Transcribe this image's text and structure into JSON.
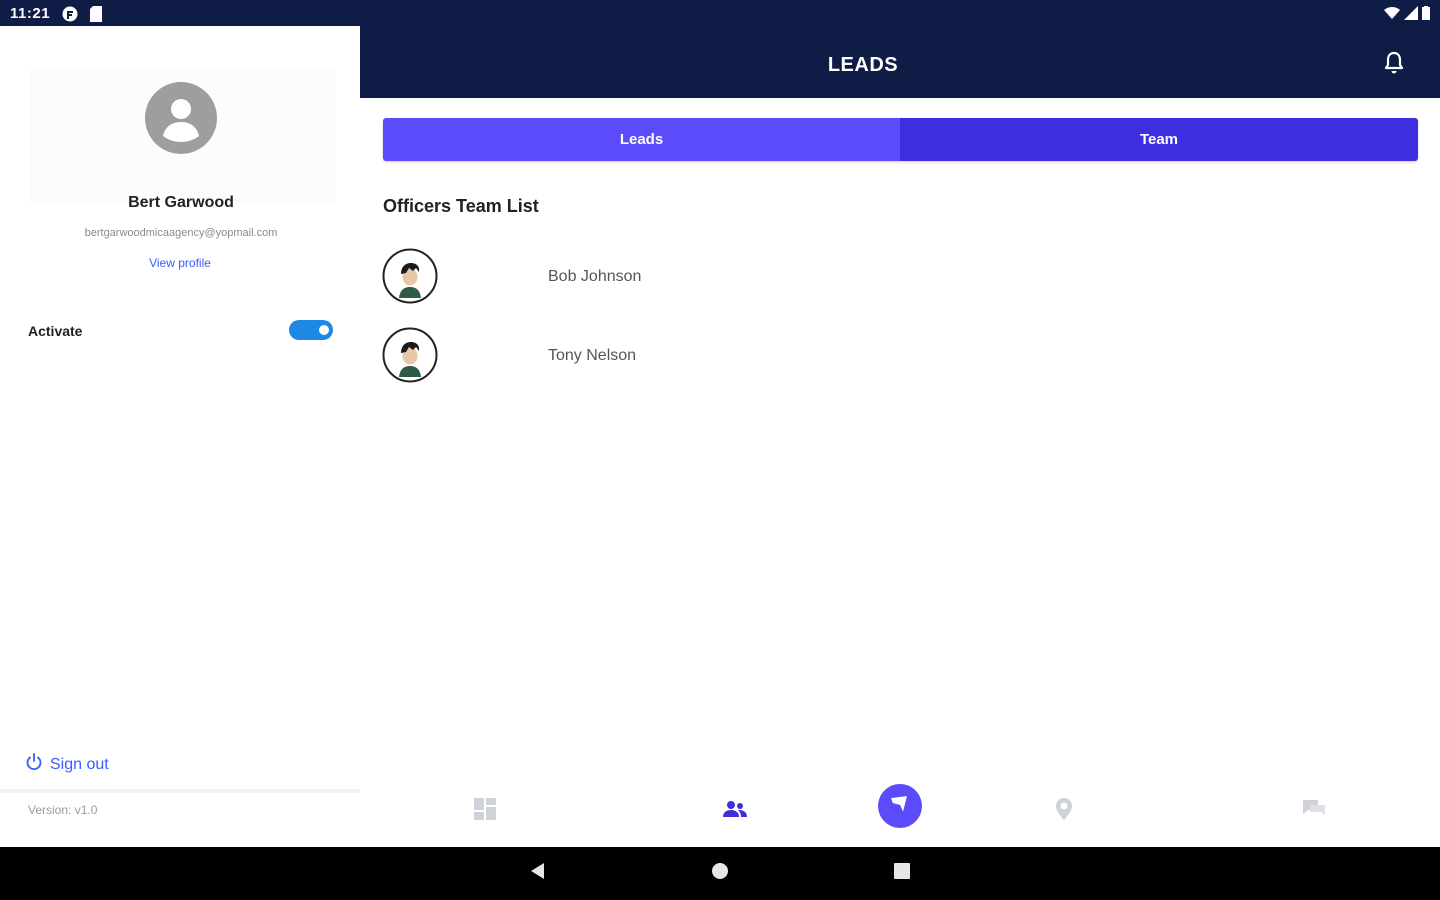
{
  "status_bar": {
    "time": "11:21"
  },
  "header": {
    "title": "LEADS"
  },
  "drawer": {
    "name": "Bert Garwood",
    "email": "bertgarwoodmicaagency@yopmail.com",
    "view_profile": "View profile",
    "activate_label": "Activate",
    "activate_on": true,
    "sign_out": "Sign out",
    "version": "Version: v1.0"
  },
  "tabs": [
    {
      "label": "Leads"
    },
    {
      "label": "Team",
      "selected": true
    }
  ],
  "section_title": "Officers Team List",
  "team_members": [
    {
      "name": "Bob Johnson"
    },
    {
      "name": "Tony Nelson"
    }
  ],
  "bottom_nav": {
    "items": [
      "dashboard-icon",
      "team-icon",
      "send-icon",
      "location-icon",
      "chat-icon"
    ],
    "active": "team-icon"
  },
  "colors": {
    "navy": "#0e1c46",
    "primary": "#5b4bfb",
    "primary_dark": "#3d2ee0",
    "link": "#3a5bff",
    "toggle": "#1e88e5"
  }
}
